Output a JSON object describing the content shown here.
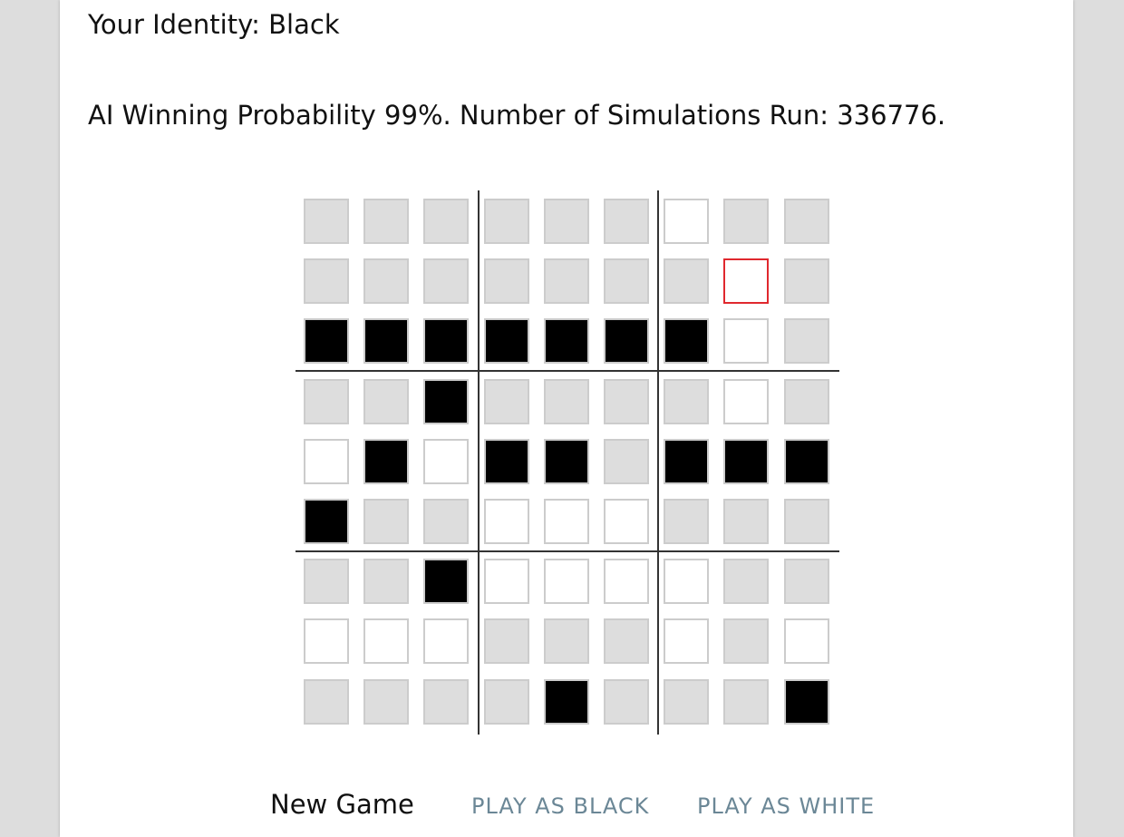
{
  "header": {
    "identity": "Your Identity: Black",
    "probability": "AI Winning Probability 99%. Number of Simulations Run: 336776."
  },
  "board": {
    "size": 9,
    "last_move": {
      "row": 1,
      "col": 7
    },
    "cells": [
      [
        "E",
        "E",
        "E",
        "E",
        "E",
        "E",
        "W",
        "E",
        "E"
      ],
      [
        "E",
        "E",
        "E",
        "E",
        "E",
        "E",
        "E",
        "L",
        "E"
      ],
      [
        "B",
        "B",
        "B",
        "B",
        "B",
        "B",
        "B",
        "W",
        "E"
      ],
      [
        "E",
        "E",
        "B",
        "E",
        "E",
        "E",
        "E",
        "W",
        "E"
      ],
      [
        "W",
        "B",
        "W",
        "B",
        "B",
        "E",
        "B",
        "B",
        "B"
      ],
      [
        "B",
        "E",
        "E",
        "W",
        "W",
        "W",
        "E",
        "E",
        "E"
      ],
      [
        "E",
        "E",
        "B",
        "W",
        "W",
        "W",
        "W",
        "E",
        "E"
      ],
      [
        "W",
        "W",
        "W",
        "E",
        "E",
        "E",
        "W",
        "E",
        "W"
      ],
      [
        "E",
        "E",
        "E",
        "E",
        "B",
        "E",
        "E",
        "E",
        "B"
      ]
    ],
    "colors": {
      "empty": "#dddddd",
      "white": "#ffffff",
      "black": "#000000",
      "last_move_border": "#e0282e",
      "cell_border": "#cccccc",
      "divider": "#333333"
    }
  },
  "controls": {
    "new_game": "New Game",
    "play_black": "PLAY AS BLACK",
    "play_white": "PLAY AS WHITE",
    "button_color": "#6b8796"
  }
}
